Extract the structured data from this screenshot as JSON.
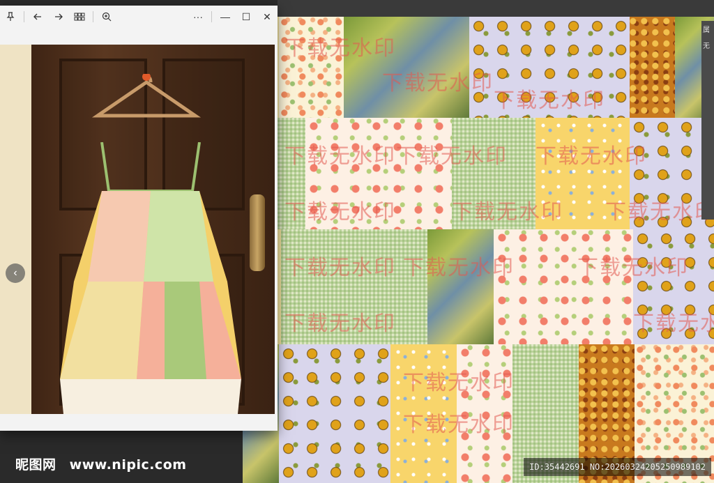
{
  "viewer": {
    "toolbar": {
      "pin_icon": "pin-icon",
      "back_icon": "arrow-left-icon",
      "forward_icon": "arrow-right-icon",
      "gallery_icon": "grid-icon",
      "zoom_icon": "zoom-in-icon",
      "more_label": "···",
      "minimize_label": "—",
      "maximize_label": "☐",
      "close_label": "✕"
    },
    "prev_label": "‹"
  },
  "canvas": {
    "watermark_text": "下载无水印",
    "stamp": "ID:35442691 NO:20260324205250989102"
  },
  "side_panel": {
    "items": [
      "属",
      "无"
    ]
  },
  "footer": {
    "logo_cn": "昵图网",
    "logo_url": "www.nipic.com"
  }
}
